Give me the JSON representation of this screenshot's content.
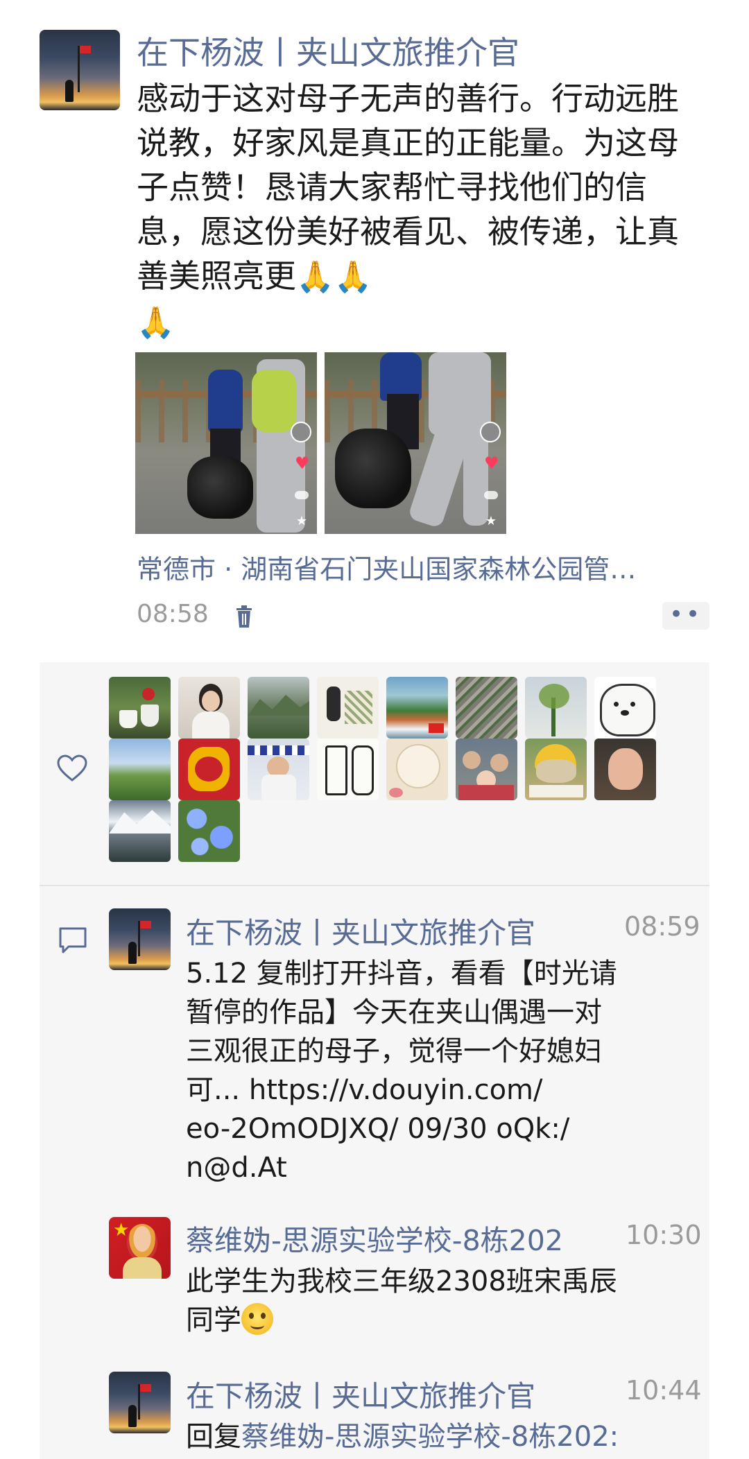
{
  "post": {
    "author": "在下杨波丨夹山文旅推介官",
    "text": "感动于这对母子无声的善行。行动远胜说教，好家风是真正的正能量。为这母子点赞！恳请大家帮忙寻找他们的信息，愿这份美好被看见、被传递，让真善美照亮更",
    "emoji_count": 3,
    "location": "常德市 · 湖南省石门夹山国家森林公园管…",
    "time": "08:58",
    "more_label": "••"
  },
  "likes": {
    "icon": "heart-icon",
    "avatars": [
      "tea-cups",
      "woman-photo",
      "mountain-forest",
      "ink-painting",
      "waterfall",
      "town-aerial",
      "orchid",
      "white-bear",
      "green-hills",
      "golden-dog",
      "soldier",
      "calligraphy",
      "poem-card",
      "family-photo",
      "yellow-cat",
      "hairless-cat",
      "snow-mountain",
      "blue-flowers"
    ]
  },
  "comments": [
    {
      "author": "在下杨波丨夹山文旅推介官",
      "time": "08:59",
      "text_lines": [
        "5.12 复制打开抖音，看看【时光请",
        "暂停的作品】今天在夹山偶遇一对",
        "三观很正的母子，觉得一个好媳妇",
        "可... https://v.douyin.com/",
        "eo-2OmODJXQ/ 09/30 oQk:/",
        "n@d.At"
      ]
    },
    {
      "author": "蔡维妫-思源实验学校-8栋202",
      "time": "10:30",
      "text_lines": [
        "此学生为我校三年级2308班宋禹辰",
        "同学"
      ]
    },
    {
      "author": "在下杨波丨夹山文旅推介官",
      "time": "10:44",
      "reply_prefix": "回复",
      "reply_to": "蔡维妫-思源实验学校-8栋202:"
    }
  ]
}
